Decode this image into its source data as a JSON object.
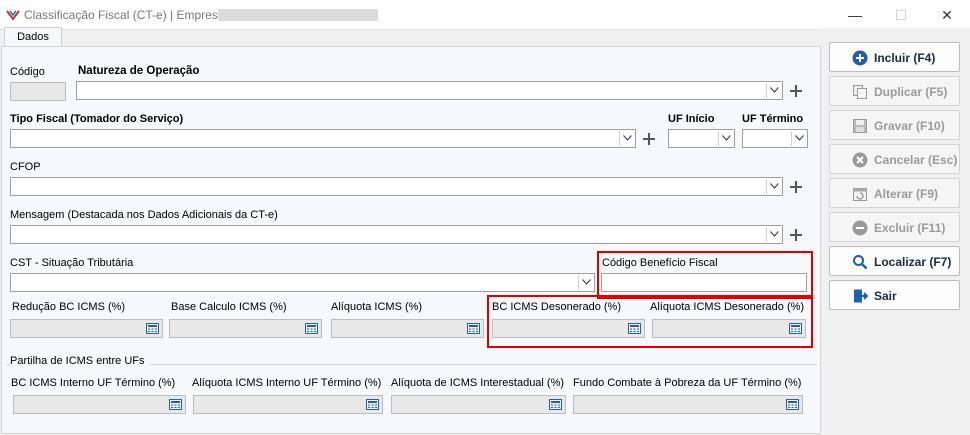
{
  "window": {
    "title": "Classificação Fiscal (CT-e) | Empresa:",
    "min_glyph": "—",
    "max_glyph": "☐",
    "close_glyph": "✕"
  },
  "tab": {
    "label": "Dados"
  },
  "form": {
    "codigo_label": "Código",
    "natureza_label": "Natureza de Operação",
    "tipo_fiscal_label": "Tipo Fiscal (Tomador do Serviço)",
    "uf_inicio_label": "UF Início",
    "uf_termino_label": "UF Término",
    "cfop_label": "CFOP",
    "mensagem_label": "Mensagem (Destacada nos Dados Adicionais da CT-e)",
    "cst_label": "CST - Situação Tributária",
    "codigo_beneficio_label": "Código Benefício Fiscal",
    "reducao_bc_label": "Redução BC ICMS (%)",
    "base_calculo_label": "Base Calculo ICMS (%)",
    "aliquota_icms_label": "Alíquota ICMS (%)",
    "bc_desonerado_label": "BC ICMS Desonerado (%)",
    "aliquota_desonerado_label": "Alíquota ICMS Desonerado (%)"
  },
  "partilha": {
    "group_title": "Partilha de ICMS entre UFs",
    "bc_interno_label": "BC ICMS Interno UF Término (%)",
    "aliquota_interno_label": "Alíquota ICMS Interno UF Término (%)",
    "aliquota_interestadual_label": "Alíquota de ICMS Interestadual (%)",
    "fundo_pobreza_label": "Fundo Combate à Pobreza da UF Término (%)"
  },
  "buttons": {
    "incluir": "Incluir (F4)",
    "duplicar": "Duplicar (F5)",
    "gravar": "Gravar (F10)",
    "cancelar": "Cancelar (Esc)",
    "alterar": "Alterar (F9)",
    "excluir": "Excluir (F11)",
    "localizar": "Localizar (F7)",
    "sair": "Sair"
  },
  "colors": {
    "highlight": "#e00000",
    "primary_icon": "#1f5fb0"
  }
}
